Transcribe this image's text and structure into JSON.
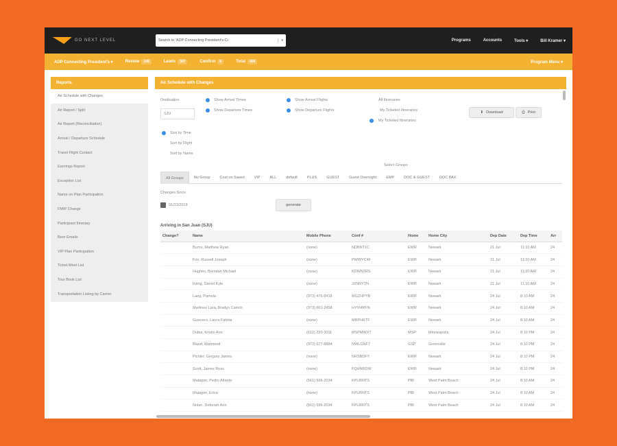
{
  "topbar": {
    "logo_text": "GO NEXT LEVEL",
    "search_placeholder": "Search in 'ADP Connecting President's Ci",
    "nav": [
      "Programs",
      "Accounts",
      "Tools",
      "Bill Kramer"
    ]
  },
  "subbar": {
    "program": "ADP Connecting President's",
    "review": "Review",
    "review_count": "149",
    "leads": "Leads",
    "leads_count": "307",
    "confirm": "Confirm",
    "confirm_count": "6",
    "total": "Total",
    "total_count": "456",
    "program_menu": "Program Menu"
  },
  "sidebar": {
    "title": "Reports",
    "items": [
      "Air Schedule with Changes",
      "Air Report / Split",
      "Air Report (Reconciliation)",
      "Arrival / Departure Schedule",
      "Travel Flight Contact",
      "Earnings Report",
      "Exception List",
      "Name on Plan Participation",
      "FMIP Change",
      "Participant Itinerary",
      "Beer Emails",
      "VIP Plan Participation",
      "Ticket Meet List",
      "Tour Book List",
      "Transportation Listing by Carrier"
    ]
  },
  "main": {
    "title": "Air Schedule with Changes",
    "destination_label": "Destination",
    "destination_value": "SJU",
    "opt_arrival_times": "Show Arrival Times",
    "opt_departure_times": "Show Departure Times",
    "opt_arrival_flights": "Show Arrival Flights",
    "opt_departure_flights": "Show Departure Flights",
    "itin_all": "All Itineraries",
    "itin_my": "My Ticketed Itineraries",
    "itin_ticketed": "My Ticketed Itineraries",
    "download": "Download",
    "print": "Print",
    "sort_time": "Sort by Time",
    "sort_flight": "Sort by Flight",
    "sort_name": "Sort by Name",
    "select_groups": "Select Groups",
    "changes_since_label": "Changes Since",
    "changes_since_value": "01/23/2019",
    "generate": "generate",
    "section_title": "Arriving in San Juan (SJU)"
  },
  "tabs": [
    "All Groups",
    "No Group",
    "Cost on Saved",
    "VIP",
    "ALL",
    "default",
    "PLUS",
    "GUEST",
    "Guest Overnight",
    "EMP",
    "DOC & GUEST",
    "DOC PAX"
  ],
  "table": {
    "columns": [
      "Change?",
      "Name",
      "Mobile Phone",
      "Conf #",
      "Home",
      "Home City",
      "Dep Date",
      "Dep Time",
      "Arr"
    ],
    "rows": [
      [
        "",
        "Burns, Matthew Ryan",
        "(none)",
        "NDBNT1C",
        "EWR",
        "Newark",
        "21 Jul",
        "11:10 AM",
        "24"
      ],
      [
        "",
        "Fox, Russell Joseph",
        "(none)",
        "PWWYC4F",
        "EWR",
        "Newark",
        "21 Jul",
        "11:10 AM",
        "24"
      ],
      [
        "",
        "Hughes, Brendan Michael",
        "(none)",
        "KDWN3RS",
        "EWR",
        "Newark",
        "21 Jul",
        "11:10 AM",
        "24"
      ],
      [
        "",
        "Irving, Daniel Kyle",
        "(none)",
        "JZNRYTN",
        "EWR",
        "Newark",
        "21 Jul",
        "11:10 AM",
        "24"
      ],
      [
        "",
        "Lang, Pamela",
        "(973) 476-8418",
        "MGZHPYB",
        "EWR",
        "Newark",
        "24 Jul",
        "8:10 AM",
        "24"
      ],
      [
        "",
        "Martinez Lara, Bradyn Camilo",
        "(973) 601-2458",
        "HYVHRFN",
        "EWR",
        "Newark",
        "24 Jul",
        "8:10 AM",
        "24"
      ],
      [
        "",
        "Guerrero, Laura Fatima",
        "(none)",
        "MRPHKTF",
        "EWR",
        "Newark",
        "24 Jul",
        "8:10 AM",
        "24"
      ],
      [
        "",
        "Dutka, Kristin Ann",
        "(612) 220-3011",
        "MSPMWXT",
        "MSP",
        "Minneapolis",
        "24 Jul",
        "8:10 PM",
        "24"
      ],
      [
        "",
        "Bland, Marmond",
        "(973) 677-8884",
        "NWLGNFT",
        "GSP",
        "Greenville",
        "24 Jul",
        "8:10 PM",
        "24"
      ],
      [
        "",
        "Pichler, Gregory James",
        "(none)",
        "NRSBDFY",
        "EWR",
        "Newark",
        "24 Jul",
        "8:10 PM",
        "24"
      ],
      [
        "",
        "Scott, James Ross",
        "(none)",
        "FQHNRDW",
        "EWR",
        "Newark",
        "24 Jul",
        "8:10 PM",
        "24"
      ],
      [
        "",
        "Malagon, Pedro Alberto",
        "(561) 596-2034",
        "KPLRMTS",
        "PBI",
        "West Palm Beach",
        "24 Jul",
        "8:10 AM",
        "24"
      ],
      [
        "",
        "Malagon, Erica",
        "(none)",
        "KPLRMTS",
        "PBI",
        "West Palm Beach",
        "24 Jul",
        "8:10 AM",
        "24"
      ],
      [
        "",
        "Nolan, Deborah Ann",
        "(561) 596-2034",
        "KPLRMTS",
        "PBI",
        "West Palm Beach",
        "24 Jul",
        "8:10 AM",
        "24"
      ]
    ]
  },
  "colors": {
    "background": "#f26a23",
    "topbar": "#1f1f1f",
    "accent": "#f4b233",
    "radio": "#3a8ee6"
  }
}
